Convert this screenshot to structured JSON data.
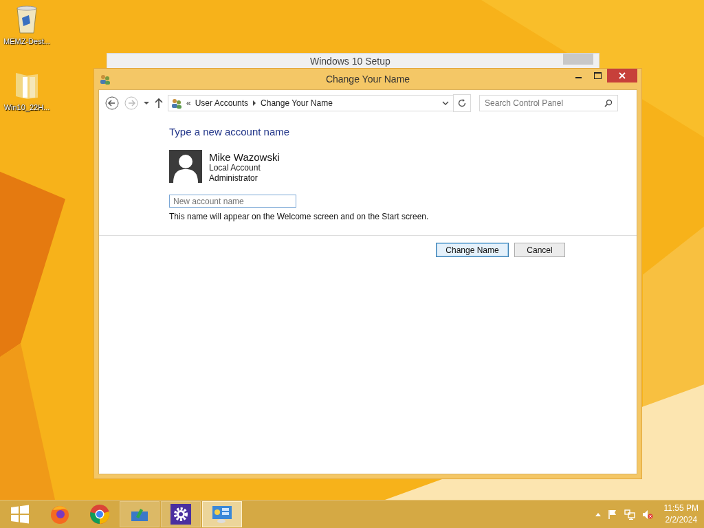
{
  "desktop_icons": [
    {
      "kind": "recycle",
      "label": "MEMZ-Dest..."
    },
    {
      "kind": "folder",
      "label": "Win10_22H..."
    }
  ],
  "background_window": {
    "title": "Windows 10 Setup"
  },
  "window": {
    "title": "Change Your Name",
    "breadcrumb": [
      "«",
      "User Accounts",
      "Change Your Name"
    ],
    "search": {
      "placeholder": "Search Control Panel"
    },
    "heading": "Type a new account name",
    "account": {
      "name": "Mike Wazowski",
      "type": "Local Account",
      "role": "Administrator"
    },
    "name_field": {
      "placeholder": "New account name"
    },
    "hint": "This name will appear on the Welcome screen and on the Start screen.",
    "buttons": [
      {
        "label": "Change Name",
        "default": true
      },
      {
        "label": "Cancel",
        "default": false
      }
    ]
  },
  "taskbar": {
    "items": [
      {
        "kind": "start",
        "running": false,
        "selected": false
      },
      {
        "kind": "firefox",
        "running": false,
        "selected": false
      },
      {
        "kind": "chrome",
        "running": false,
        "selected": false
      },
      {
        "kind": "setup",
        "running": true,
        "selected": false
      },
      {
        "kind": "settings",
        "running": true,
        "selected": false
      },
      {
        "kind": "control",
        "running": true,
        "selected": true
      }
    ],
    "time": "11:55 PM",
    "date": "2/2/2024"
  }
}
